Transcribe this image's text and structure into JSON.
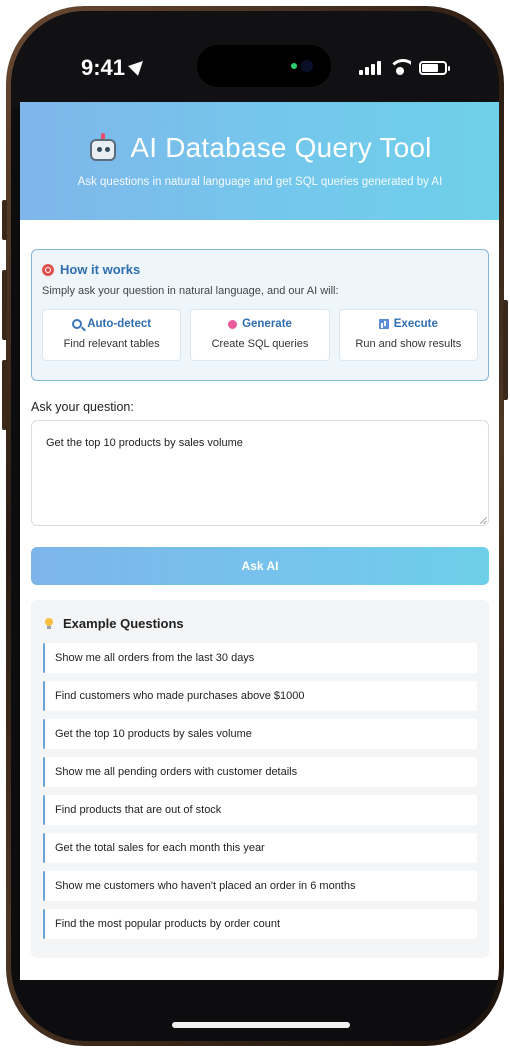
{
  "status_bar": {
    "time": "9:41"
  },
  "header": {
    "title": "AI Database Query Tool",
    "subtitle": "Ask questions in natural language and get SQL queries generated by AI"
  },
  "how_it_works": {
    "title": "How it works",
    "description": "Simply ask your question in natural language, and our AI will:",
    "features": [
      {
        "title": "Auto-detect",
        "desc": "Find relevant tables"
      },
      {
        "title": "Generate",
        "desc": "Create SQL queries"
      },
      {
        "title": "Execute",
        "desc": "Run and show results"
      }
    ]
  },
  "question": {
    "label": "Ask your question:",
    "value": "Get the top 10 products by sales volume"
  },
  "ask_button": {
    "label": "Ask AI"
  },
  "examples": {
    "title": "Example Questions",
    "items": [
      "Show me all orders from the last 30 days",
      "Find customers who made purchases above $1000",
      "Get the top 10 products by sales volume",
      "Show me all pending orders with customer details",
      "Find products that are out of stock",
      "Get the total sales for each month this year",
      "Show me customers who haven't placed an order in 6 months",
      "Find the most popular products by order count"
    ]
  },
  "colors": {
    "header_gradient_start": "#7fb6ea",
    "header_gradient_end": "#6fd0ea",
    "accent_blue": "#2f6fb0",
    "info_box_border": "#7fb6d9",
    "info_box_bg": "#eef6fb",
    "examples_bg": "#f4f5f7"
  }
}
